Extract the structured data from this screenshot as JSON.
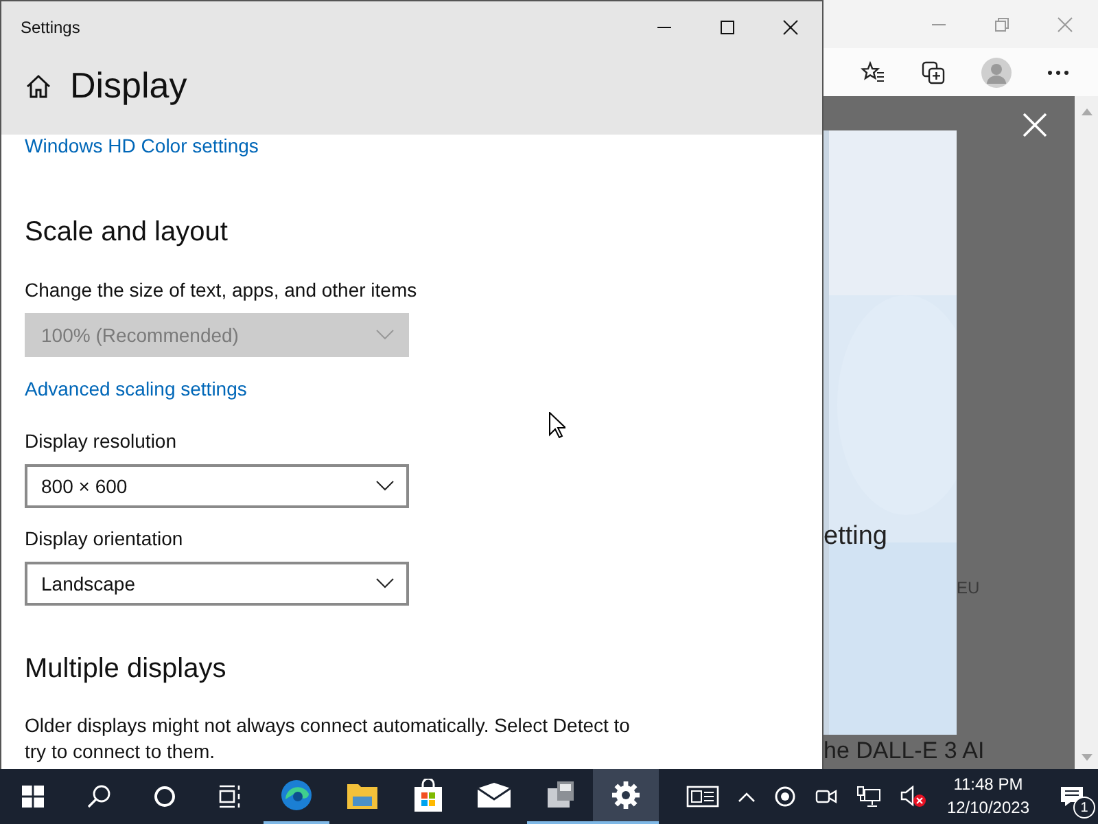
{
  "settings_window": {
    "title": "Settings",
    "page_title": "Display",
    "items": [
      {
        "kind": "link",
        "text": "Windows HD Color settings"
      },
      {
        "kind": "heading",
        "text": "Scale and layout"
      },
      {
        "kind": "label",
        "text": "Change the size of text, apps, and other items"
      },
      {
        "kind": "dropdown",
        "text": "100% (Recommended)",
        "disabled": true
      },
      {
        "kind": "link",
        "text": "Advanced scaling settings"
      },
      {
        "kind": "label",
        "text": "Display resolution"
      },
      {
        "kind": "dropdown",
        "text": "800 × 600",
        "disabled": false
      },
      {
        "kind": "label",
        "text": "Display orientation"
      },
      {
        "kind": "dropdown",
        "text": "Landscape",
        "disabled": false
      },
      {
        "kind": "heading",
        "text": "Multiple displays"
      },
      {
        "kind": "paragraph",
        "text": "Older displays might not always connect automatically. Select Detect to try to connect to them."
      }
    ]
  },
  "browser_page": {
    "heading_fragment": "etting",
    "tag_fragment": "EU",
    "caption_fragment": "he DALL-E 3 AI"
  },
  "taskbar": {
    "apps": [
      {
        "kind": "edge",
        "running": true,
        "selected": false
      },
      {
        "kind": "explorer",
        "running": false,
        "selected": false
      },
      {
        "kind": "store",
        "running": false,
        "selected": false
      },
      {
        "kind": "mail",
        "running": false,
        "selected": false
      },
      {
        "kind": "app",
        "running": true,
        "selected": false
      },
      {
        "kind": "settings",
        "running": true,
        "selected": true
      }
    ],
    "time": "11:48 PM",
    "date": "12/10/2023",
    "notification_count": "1"
  }
}
